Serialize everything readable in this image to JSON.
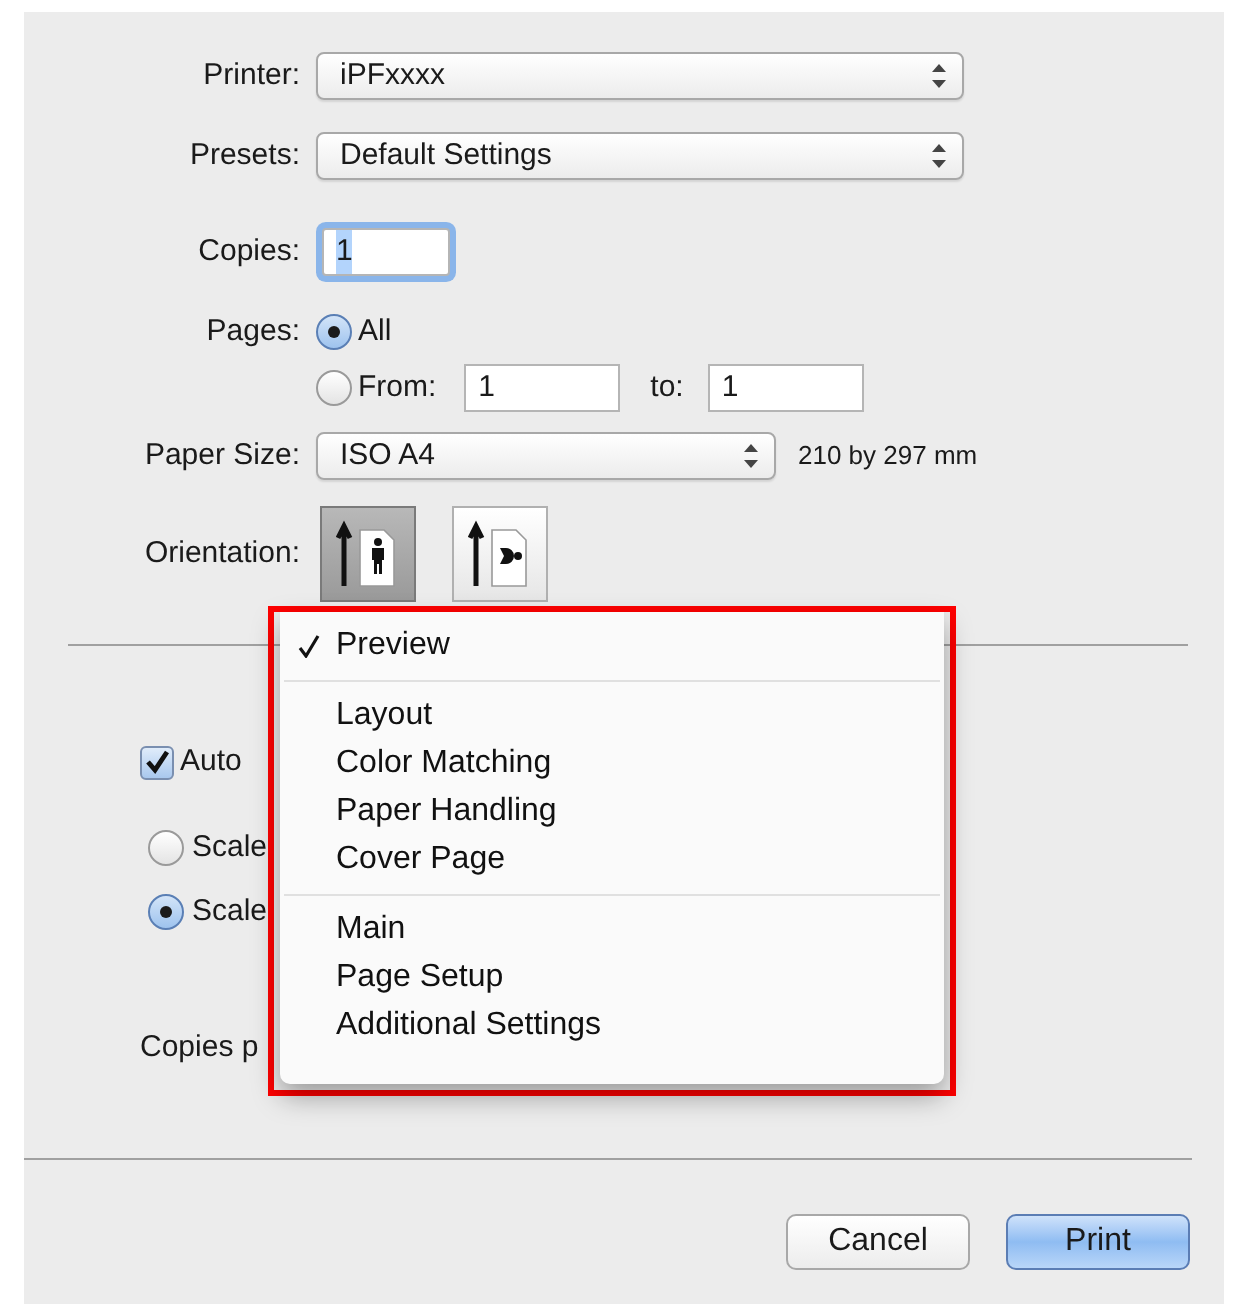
{
  "printer": {
    "label": "Printer:",
    "value": "iPFxxxx"
  },
  "presets": {
    "label": "Presets:",
    "value": "Default Settings"
  },
  "copies": {
    "label": "Copies:",
    "value": "1"
  },
  "pages": {
    "label": "Pages:",
    "options": [
      {
        "label": "All",
        "selected": true
      },
      {
        "label": "From:",
        "selected": false
      }
    ],
    "from": "1",
    "to_label": "to:",
    "to": "1"
  },
  "paper_size": {
    "label": "Paper Size:",
    "value": "ISO A4",
    "dimensions": "210 by 297 mm"
  },
  "orientation": {
    "label": "Orientation:",
    "options": [
      {
        "kind": "portrait",
        "selected": true
      },
      {
        "kind": "landscape",
        "selected": false
      }
    ]
  },
  "behind_menu": {
    "checkbox": {
      "label": "Auto",
      "checked": true
    },
    "scale_options": [
      {
        "label": "Scale",
        "selected": false
      },
      {
        "label": "Scale",
        "selected": true
      }
    ],
    "copies_per": "Copies p"
  },
  "menu": {
    "groups": [
      [
        {
          "label": "Preview",
          "selected": true
        }
      ],
      [
        {
          "label": "Layout",
          "selected": false
        },
        {
          "label": "Color Matching",
          "selected": false
        },
        {
          "label": "Paper Handling",
          "selected": false
        },
        {
          "label": "Cover Page",
          "selected": false
        }
      ],
      [
        {
          "label": "Main",
          "selected": false
        },
        {
          "label": "Page Setup",
          "selected": false
        },
        {
          "label": "Additional Settings",
          "selected": false
        }
      ]
    ]
  },
  "buttons": [
    {
      "label": "Cancel",
      "kind": "secondary"
    },
    {
      "label": "Print",
      "kind": "default"
    }
  ]
}
